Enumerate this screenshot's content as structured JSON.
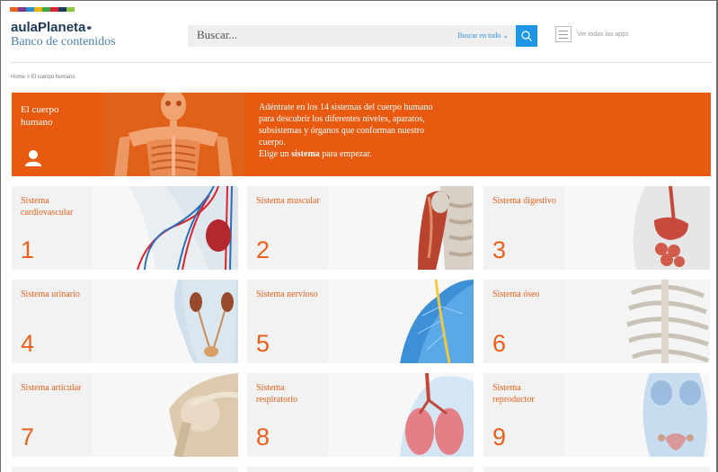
{
  "brand": {
    "name": "aulaPlaneta",
    "subtitle": "Banco de contenidos",
    "strip_colors": [
      "#e8601c",
      "#7a3b8f",
      "#2c8ed6",
      "#f5b400",
      "#3aa845",
      "#d9232d",
      "#1e3a5a",
      "#8cc63f"
    ]
  },
  "search": {
    "placeholder": "Buscar...",
    "scope_label": "Buscar en todo ⌄"
  },
  "apps": {
    "label": "Ver todas las apps"
  },
  "breadcrumb": "Home > El cuerpo humano",
  "hero": {
    "title": "El cuerpo humano",
    "description_lines": [
      "Adéntrate en los 14 sistemas del cuerpo humano",
      "para descubrir los diferentes niveles, aparatos,",
      "subsistemas y órganos que conforman nuestro",
      "cuerpo."
    ],
    "cta_prefix": "Elige un ",
    "cta_bold": "sistema",
    "cta_suffix": " para empezar.",
    "background": "#e85a0f"
  },
  "accent_color": "#e8601c",
  "systems": [
    {
      "label": "Sistema cardiovascular",
      "number": "1",
      "icon": "heart-vessels-illustration"
    },
    {
      "label": "Sistema muscular",
      "number": "2",
      "icon": "muscle-arm-illustration"
    },
    {
      "label": "Sistema digestivo",
      "number": "3",
      "icon": "digestive-organs-illustration"
    },
    {
      "label": "Sistema urinario",
      "number": "4",
      "icon": "kidneys-illustration"
    },
    {
      "label": "Sistema nervioso",
      "number": "5",
      "icon": "spine-nerves-illustration"
    },
    {
      "label": "Sistema óseo",
      "number": "6",
      "icon": "ribcage-illustration"
    },
    {
      "label": "Sistema articular",
      "number": "7",
      "icon": "shoulder-joint-illustration"
    },
    {
      "label": "Sistema respiratorio",
      "number": "8",
      "icon": "lungs-illustration"
    },
    {
      "label": "Sistema reproductor",
      "number": "9",
      "icon": "reproductive-illustration"
    }
  ]
}
